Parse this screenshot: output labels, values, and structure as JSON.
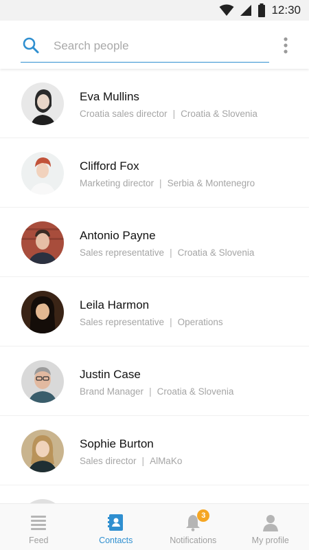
{
  "status_bar": {
    "time": "12:30",
    "icons": [
      "wifi-icon",
      "signal-icon",
      "battery-icon"
    ]
  },
  "search": {
    "placeholder": "Search people",
    "value": "",
    "icon": "search-icon",
    "menu_icon": "more-vertical-icon"
  },
  "contacts": [
    {
      "name": "Eva Mullins",
      "title": "Croatia sales director",
      "region": "Croatia & Slovenia"
    },
    {
      "name": "Clifford Fox",
      "title": "Marketing director",
      "region": "Serbia & Montenegro"
    },
    {
      "name": "Antonio Payne",
      "title": "Sales representative",
      "region": "Croatia & Slovenia"
    },
    {
      "name": "Leila Harmon",
      "title": "Sales representative",
      "region": "Operations"
    },
    {
      "name": "Justin Case",
      "title": "Brand Manager",
      "region": "Croatia & Slovenia"
    },
    {
      "name": "Sophie Burton",
      "title": "Sales director",
      "region": "AlMaKo"
    }
  ],
  "separator": "|",
  "bottom_nav": {
    "items": [
      {
        "label": "Feed",
        "icon": "feed-icon",
        "active": false
      },
      {
        "label": "Contacts",
        "icon": "contacts-icon",
        "active": true
      },
      {
        "label": "Notifications",
        "icon": "bell-icon",
        "active": false,
        "badge": "3"
      },
      {
        "label": "My profile",
        "icon": "profile-icon",
        "active": false
      }
    ]
  },
  "colors": {
    "accent": "#2f8fd0",
    "badge": "#f5a623",
    "muted_text": "#a5a5a5",
    "status_bar_bg": "#f2f2f2"
  }
}
